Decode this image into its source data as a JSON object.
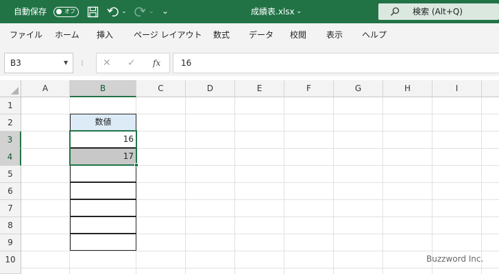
{
  "title_bar": {
    "autosave_label": "自動保存",
    "autosave_state": "オフ",
    "undo_dropdown": "⌄",
    "redo_dropdown": "⌄",
    "qat_more": "⌄",
    "filename": "成績表.xlsx",
    "filename_chevron": "⌄",
    "search_text": "検索 (Alt+Q)",
    "colors": {
      "title_bar": "#217346"
    },
    "icons": [
      "save-icon",
      "undo-icon",
      "redo-icon",
      "search-icon"
    ]
  },
  "menu": {
    "items": [
      "ファイル",
      "ホーム",
      "挿入",
      "ページ レイアウト",
      "数式",
      "データ",
      "校閲",
      "表示",
      "ヘルプ"
    ]
  },
  "formula_bar": {
    "name_box": "B3",
    "name_box_dropdown": "▼",
    "separator": "⁝",
    "cancel": "✕",
    "enter": "✓",
    "fx": "fx",
    "formula": "16"
  },
  "grid": {
    "columns": [
      "A",
      "B",
      "C",
      "D",
      "E",
      "F",
      "G",
      "H",
      "I"
    ],
    "rows": [
      "1",
      "2",
      "3",
      "4",
      "5",
      "6",
      "7",
      "8",
      "9",
      "10"
    ],
    "selected_column": "B",
    "selected_rows": [
      "3",
      "4"
    ],
    "active_cell": "B3",
    "selection_range": "B3:B4"
  },
  "sheet": {
    "header": "数値",
    "values": [
      "16",
      "17"
    ]
  },
  "watermark": "Buzzword Inc."
}
